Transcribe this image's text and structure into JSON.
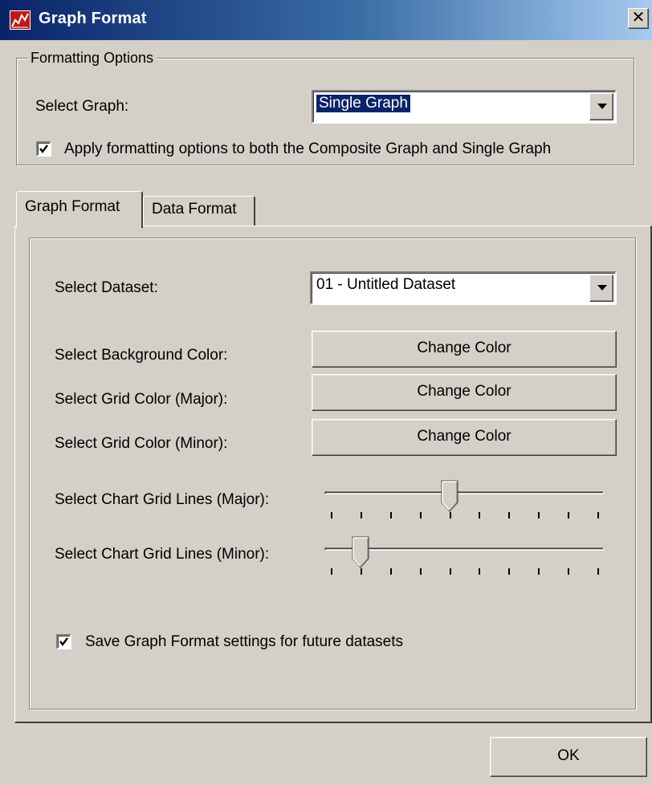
{
  "window": {
    "title": "Graph Format",
    "close_symbol": "✕",
    "app_icon": "graph-app-icon"
  },
  "formatting_options": {
    "group_label": "Formatting Options",
    "select_graph_label": "Select Graph:",
    "select_graph_value": "Single Graph",
    "apply_both_label": "Apply formatting options to both the Composite Graph and Single Graph",
    "apply_both_checked": true
  },
  "tabs": [
    {
      "label": "Graph Format",
      "active": true
    },
    {
      "label": "Data Format",
      "active": false
    }
  ],
  "graph_format": {
    "select_dataset_label": "Select Dataset:",
    "select_dataset_value": "01 - Untitled Dataset",
    "background_color_label": "Select Background Color:",
    "grid_major_color_label": "Select Grid Color (Major):",
    "grid_minor_color_label": "Select Grid Color (Minor):",
    "change_color_label": "Change Color",
    "grid_lines_major_label": "Select Chart Grid Lines (Major):",
    "grid_lines_minor_label": "Select Chart Grid Lines (Minor):",
    "grid_lines_major": {
      "value": 4,
      "min": 0,
      "max": 9
    },
    "grid_lines_minor": {
      "value": 1,
      "min": 0,
      "max": 9
    },
    "save_settings_label": "Save Graph Format settings for future datasets",
    "save_settings_checked": true
  },
  "footer": {
    "ok_label": "OK"
  },
  "colors": {
    "titlebar_start": "#0a246a",
    "titlebar_end": "#a6caf0",
    "dialog_face": "#d4d0c8",
    "selection": "#0a246a"
  }
}
